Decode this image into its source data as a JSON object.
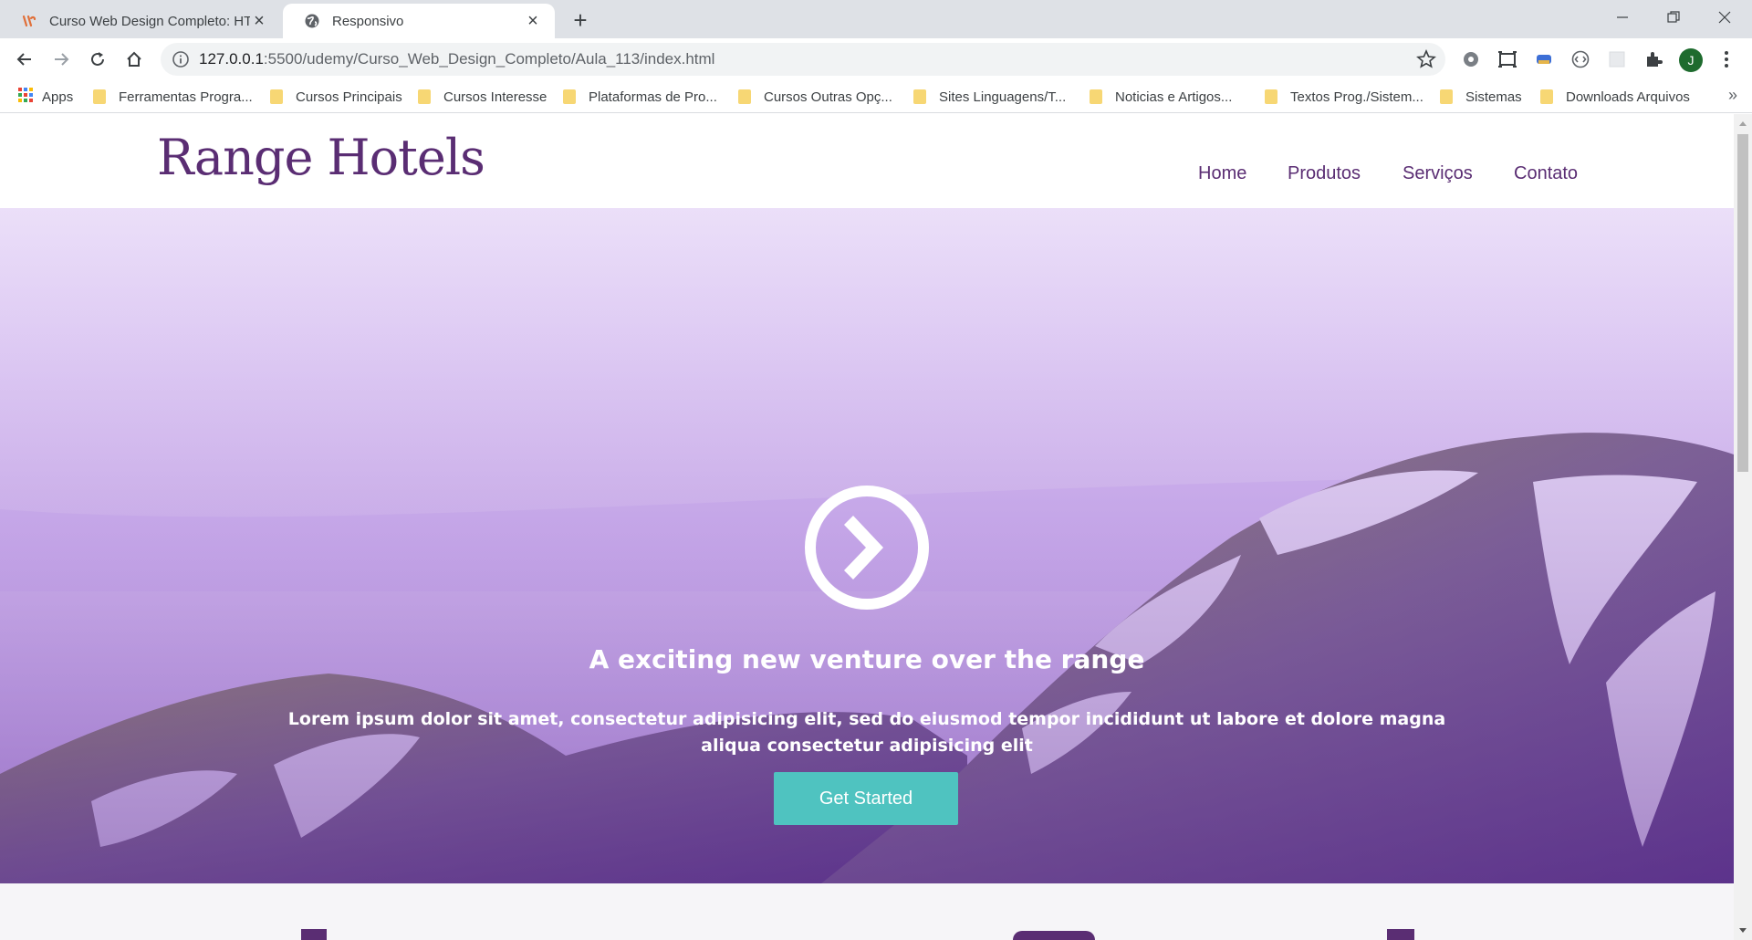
{
  "browser": {
    "tabs": [
      {
        "title": "Curso Web Design Completo: HT",
        "active": false,
        "icon": "udemy-icon"
      },
      {
        "title": "Responsivo",
        "active": true,
        "icon": "globe-icon"
      }
    ],
    "url_host": "127.0.0.1",
    "url_rest": ":5500/udemy/Curso_Web_Design_Completo/Aula_113/index.html",
    "profile_initial": "J",
    "bookmarks": [
      "Apps",
      "Ferramentas Progra...",
      "Cursos Principais",
      "Cursos Interesse",
      "Plataformas de Pro...",
      "Cursos Outras Opç...",
      "Sites Linguagens/T...",
      "Noticias e Artigos...",
      "Textos Prog./Sistem...",
      "Sistemas",
      "Downloads Arquivos"
    ],
    "bookmarks_more": "»"
  },
  "site": {
    "logo": "Range Hotels",
    "menu": [
      "Home",
      "Produtos",
      "Serviços",
      "Contato"
    ],
    "hero": {
      "icon": "chevron-circle-icon",
      "title": "A exciting new venture over the range",
      "text": "Lorem ipsum dolor sit amet, consectetur adipisicing elit, sed do eiusmod tempor incididunt ut labore et dolore magna aliqua consectetur adipisicing elit",
      "cta": "Get Started"
    }
  },
  "colors": {
    "brand": "#5a2d73",
    "cta": "#4fc3c0",
    "hero_overlay": "#b994e8"
  }
}
